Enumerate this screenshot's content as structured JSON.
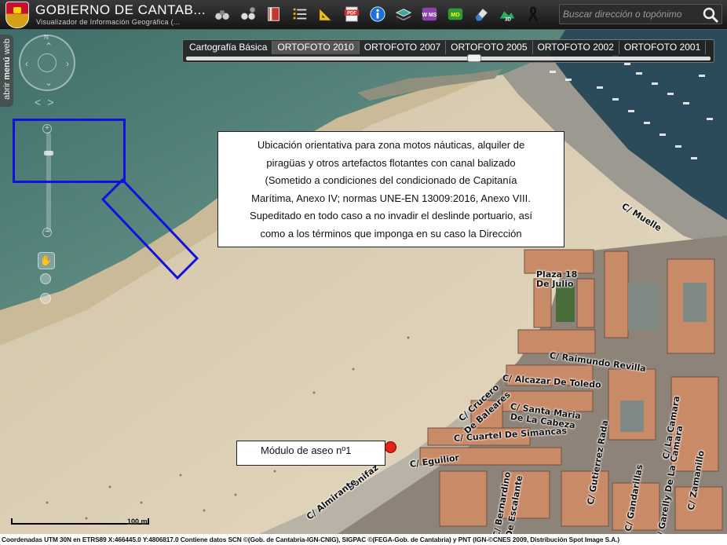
{
  "header": {
    "title": "GOBIERNO DE CANTAB...",
    "subtitle": "Visualizador de Información Geográfica (...",
    "tools": [
      {
        "icon": "binoculars-icon"
      },
      {
        "icon": "binoculars-settings-icon"
      },
      {
        "icon": "book-icon"
      },
      {
        "icon": "list-icon"
      },
      {
        "icon": "ruler-icon"
      },
      {
        "icon": "pdf-icon"
      },
      {
        "icon": "info-icon"
      },
      {
        "icon": "layers-icon"
      },
      {
        "icon": "wms-icon"
      },
      {
        "icon": "md-icon"
      },
      {
        "icon": "eraser-icon"
      },
      {
        "icon": "3d-icon"
      },
      {
        "icon": "ribbon-icon"
      }
    ],
    "pdf_label": "PDF",
    "wms_label": "W MS",
    "md_label": "MD",
    "threed_label": "3D",
    "search_placeholder": "Buscar dirección o topónimo"
  },
  "side_menu": {
    "label_prefix": "abrir ",
    "label_bold": "menú",
    "label_suffix": " web"
  },
  "navigation": {
    "north_label": "N",
    "zoom_in": "+",
    "zoom_out": "−",
    "left": "<",
    "right": ">"
  },
  "layer_tabs": [
    {
      "label": "Cartografía Básica",
      "active": false
    },
    {
      "label": "ORTOFOTO 2010",
      "active": true
    },
    {
      "label": "ORTOFOTO 2007",
      "active": false
    },
    {
      "label": "ORTOFOTO 2005",
      "active": false
    },
    {
      "label": "ORTOFOTO 2002",
      "active": false
    },
    {
      "label": "ORTOFOTO 2001",
      "active": false
    }
  ],
  "annotation": {
    "lines": [
      "Ubicación orientativa para zona motos náuticas, alquiler de",
      "piragüas y otros artefactos flotantes con canal balizado",
      "(Sometido a condiciones del condicionado de Capitanía",
      "Marítima, Anexo IV; normas UNE-EN 13009:2016, Anexo VIII.",
      "Supeditado en todo caso a no invadir el deslinde portuario, así",
      "como a los términos que imponga en su caso la Dirección"
    ],
    "module_label": "Módulo de aseo nº1"
  },
  "streets": [
    {
      "text": "C/  Muelle"
    },
    {
      "text": "Plaza 18"
    },
    {
      "text": "De Julio"
    },
    {
      "text": "C/  Raimundo  Revilla"
    },
    {
      "text": "C/  Alcazar De Toledo"
    },
    {
      "text": "C/  Santa Maria"
    },
    {
      "text": "De La Cabeza"
    },
    {
      "text": "C/  Crucero"
    },
    {
      "text": "De Baleares"
    },
    {
      "text": "C/  Cuartel De Simancas"
    },
    {
      "text": "C/  Eguilior"
    },
    {
      "text": "Bonifaz"
    },
    {
      "text": "C/  Almirante"
    },
    {
      "text": "C/  Gutierrez  Rada"
    },
    {
      "text": "C/  Gandarillas"
    },
    {
      "text": "C/  La  Camara"
    },
    {
      "text": "C/  Garelly  De  La  Camara"
    },
    {
      "text": "C/  Zamanillo"
    },
    {
      "text": "C/  Bernardino"
    },
    {
      "text": "De  Escalante"
    }
  ],
  "scale_label": "100 m",
  "footer": "Coordenadas UTM 30N en ETRS89 X:466445.0 Y:4806817.0    Contiene datos SCN ©(Gob. de Cantabria-IGN-CNIG), SIGPAC ©(FEGA-Gob. de Cantabria) y PNT (IGN-©CNES 2009, Distribución Spot Image S.A.)",
  "colors": {
    "annotation_outline": "#1010e0",
    "marker": "#e2231a",
    "sea": "#4f7f78",
    "sand": "#d8c9ae"
  }
}
